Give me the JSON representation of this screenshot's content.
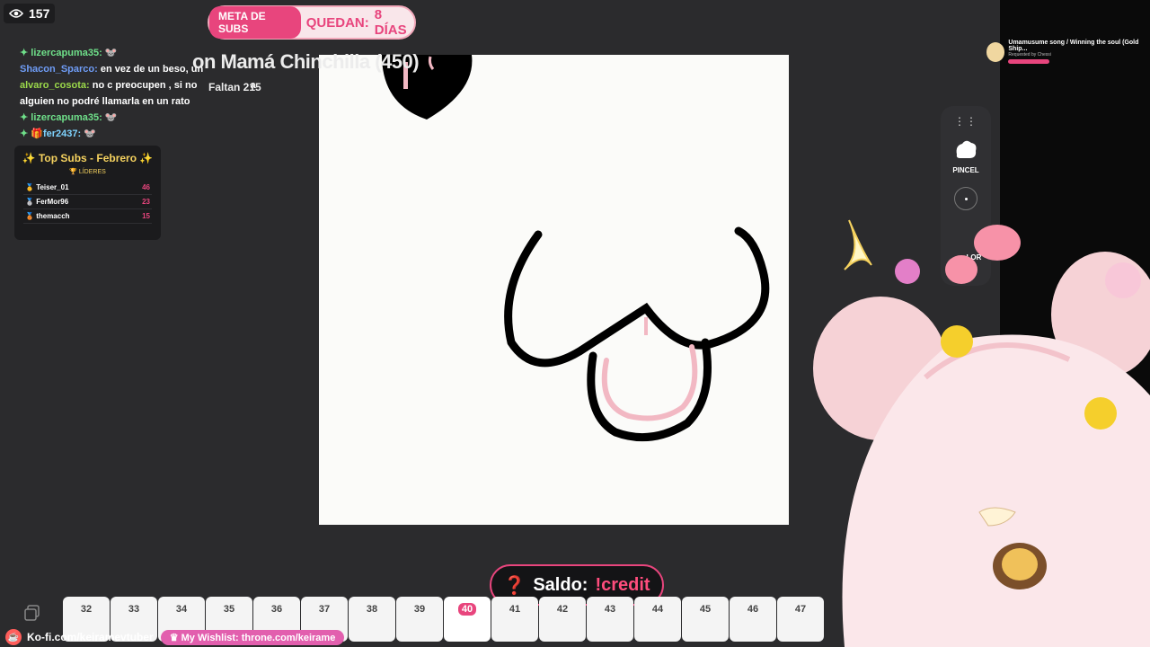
{
  "viewers": {
    "count": "157"
  },
  "sub_goal": {
    "label": "META DE SUBS",
    "remaining_label": "QUEDAN:",
    "remaining_value": "8 DÍAS"
  },
  "chat": [
    {
      "user": "lizercapuma35:",
      "text": "",
      "color": "green"
    },
    {
      "user": "Shacon_Sparco:",
      "text": "en vez de un beso, un",
      "color": "blue"
    },
    {
      "user": "alvaro_cosota:",
      "text": "no c preocupen , si no",
      "text2": "a",
      "color": "lime"
    },
    {
      "user": "",
      "text": "alguien no podré llamarla en un rato",
      "color": ""
    },
    {
      "user": "lizercapuma35:",
      "text": "",
      "color": "green"
    },
    {
      "user": "fer2437:",
      "text": "",
      "color": "cyan"
    }
  ],
  "top_subs": {
    "title": "✨ Top Subs - Febrero ✨",
    "subtitle": "LÍDERES",
    "rows": [
      {
        "name": "Teiser_01",
        "count": "46"
      },
      {
        "name": "FerMor96",
        "count": "23"
      },
      {
        "name": "themacch",
        "count": "15"
      }
    ]
  },
  "goal_overlay": {
    "text": "on Mamá Chinchilla (450)",
    "faltan": "Faltan 215"
  },
  "toolbar": {
    "brush_label": "PINCEL",
    "color_label": "LOR"
  },
  "song": {
    "title": "Umamusume song / Winning the soul (Gold Ship...",
    "requested": "Requested by Chessi"
  },
  "saldo": {
    "label": "Saldo:",
    "command": "!credit"
  },
  "frames": [
    "32",
    "33",
    "34",
    "35",
    "36",
    "37",
    "38",
    "39",
    "40",
    "41",
    "42",
    "43",
    "44",
    "45",
    "46",
    "47"
  ],
  "active_frame": "40",
  "bottom": {
    "kofi": "Ko-fi.com/keiramevtuber",
    "wishlist": "My Wishlist: throne.com/keirame"
  },
  "colors": {
    "accent": "#e8457d",
    "background": "#2b2b2d"
  }
}
